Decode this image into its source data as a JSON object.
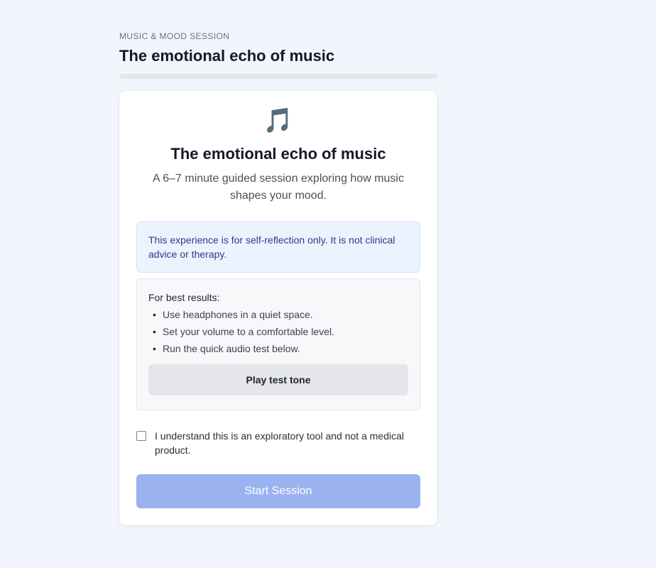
{
  "header": {
    "eyebrow": "MUSIC & MOOD SESSION",
    "title": "The emotional echo of music",
    "progress_fraction": 0
  },
  "card": {
    "icon": "music-notes-icon",
    "icon_glyph": "🎵",
    "title": "The emotional echo of music",
    "subtitle": "A 6–7 minute guided session exploring how music shapes your mood.",
    "notice": "This experience is for self-reflection only. It is not clinical advice or therapy.",
    "tips": {
      "heading": "For best results:",
      "items": [
        "Use headphones in a quiet space.",
        "Set your volume to a comfortable level.",
        "Run the quick audio test below."
      ],
      "test_button_label": "Play test tone"
    },
    "consent": {
      "checked": false,
      "label": "I understand this is an exploratory tool and not a medical product."
    },
    "start_button_label": "Start Session",
    "start_button_enabled": false
  },
  "colors": {
    "background": "#f3f5fd",
    "accent_disabled": "#9bb2f0",
    "notice_bg": "#edf3fe",
    "notice_text": "#2b3a8c"
  }
}
